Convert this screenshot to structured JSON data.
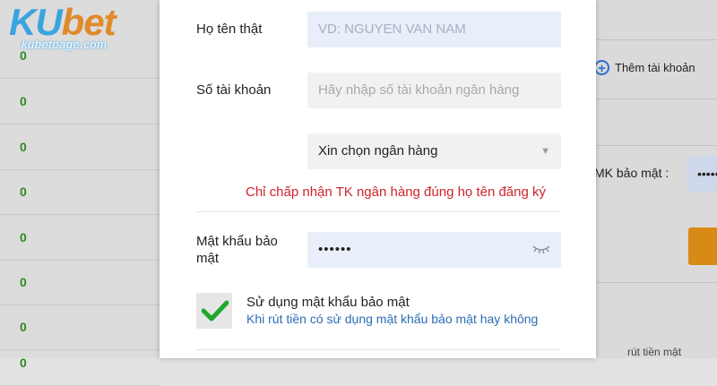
{
  "logo": {
    "brand_ku": "KU",
    "brand_bet": "bet",
    "site": "kubetpage.com"
  },
  "background": {
    "left_rows": [
      "0",
      "0",
      "0",
      "0",
      "0",
      "0",
      "0",
      "0"
    ],
    "add_account_label": "Thêm tài khoản",
    "mk_label": "MK bảo mật :",
    "mk_value": "•••••",
    "bottom_text": "rút tiền mật"
  },
  "form": {
    "real_name_label": "Họ tên thật",
    "real_name_placeholder": "VD: NGUYEN VAN NAM",
    "account_number_label": "Số tài khoản",
    "account_number_placeholder": "Hãy nhập số tài khoản ngân hàng",
    "bank_select_value": "Xin chọn ngân hàng",
    "warning": "Chỉ chấp nhận TK ngân hàng đúng họ tên đăng ký",
    "password_label": "Mật khẩu bảo mật",
    "password_value": "••••••",
    "use_password_title": "Sử dụng mật khẩu bảo mật",
    "use_password_desc": "Khi rút tiền có sử dụng mật khẩu bảo mật hay không",
    "use_password_checked": true
  },
  "colors": {
    "warning": "#d0242a",
    "check": "#1fa82c",
    "link": "#2a6db5",
    "accent_orange": "#d98a16"
  }
}
